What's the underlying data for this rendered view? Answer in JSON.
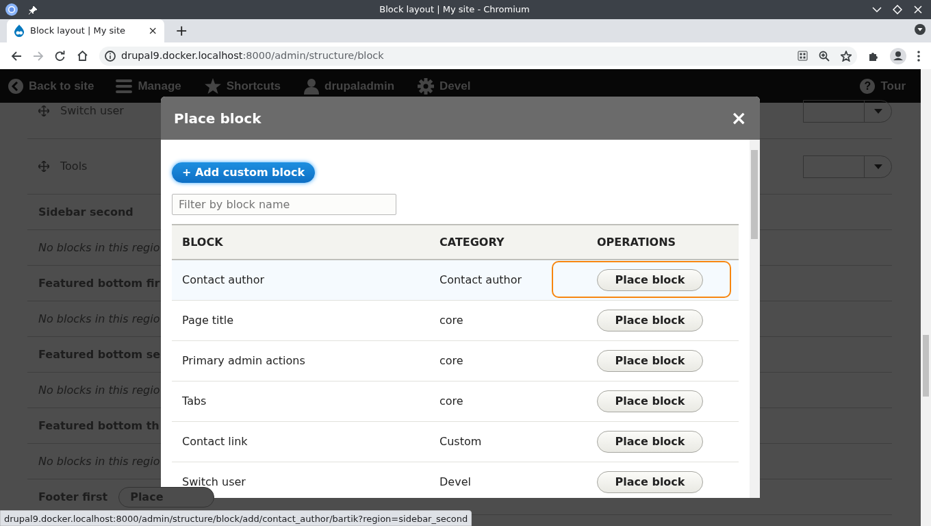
{
  "window": {
    "title": "Block layout | My site - Chromium"
  },
  "tab": {
    "title": "Block layout | My site",
    "close": "×"
  },
  "new_tab": "+",
  "url": {
    "host": "drupal9.docker.localhost",
    "path": ":8000/admin/structure/block"
  },
  "admin_toolbar": [
    {
      "label": "Back to site",
      "kind": "back"
    },
    {
      "label": "Manage",
      "kind": "menu"
    },
    {
      "label": "Shortcuts",
      "kind": "star"
    },
    {
      "label": "drupaladmin",
      "kind": "user"
    },
    {
      "label": "Devel",
      "kind": "gear"
    }
  ],
  "tour": {
    "label": "Tour",
    "icon": "?"
  },
  "background_rows": [
    {
      "kind": "block",
      "label": "Switch user"
    },
    {
      "kind": "block",
      "label": "Tools"
    },
    {
      "kind": "region",
      "label": "Sidebar second"
    },
    {
      "kind": "empty",
      "label": "No blocks in this regio"
    },
    {
      "kind": "region",
      "label": "Featured bottom fir"
    },
    {
      "kind": "empty",
      "label": "No blocks in this regio"
    },
    {
      "kind": "region",
      "label": "Featured bottom se"
    },
    {
      "kind": "empty",
      "label": "No blocks in this regio"
    },
    {
      "kind": "region",
      "label": "Featured bottom th"
    },
    {
      "kind": "empty",
      "label": "No blocks in this regio"
    },
    {
      "kind": "region",
      "label": "Footer first",
      "button": "Place"
    }
  ],
  "modal": {
    "title": "Place block",
    "close": "×",
    "add_button": "+ Add custom block",
    "filter": {
      "placeholder": "Filter by block name"
    },
    "columns": [
      "BLOCK",
      "CATEGORY",
      "OPERATIONS"
    ],
    "rows": [
      {
        "block": "Contact author",
        "category": "Contact author",
        "operation": "Place block",
        "focused": true
      },
      {
        "block": "Page title",
        "category": "core",
        "operation": "Place block",
        "focused": false
      },
      {
        "block": "Primary admin actions",
        "category": "core",
        "operation": "Place block",
        "focused": false
      },
      {
        "block": "Tabs",
        "category": "core",
        "operation": "Place block",
        "focused": false
      },
      {
        "block": "Contact link",
        "category": "Custom",
        "operation": "Place block",
        "focused": false
      },
      {
        "block": "Switch user",
        "category": "Devel",
        "operation": "Place block",
        "focused": false
      }
    ]
  },
  "status_url": "drupal9.docker.localhost:8000/admin/structure/block/add/contact_author/bartik?region=sidebar_second"
}
